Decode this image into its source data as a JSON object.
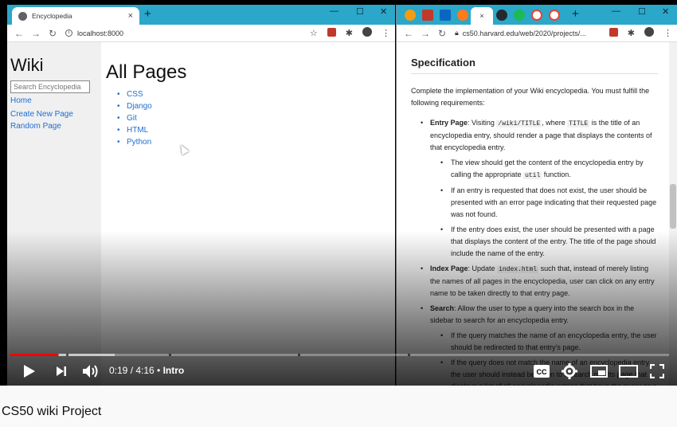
{
  "left_browser": {
    "tab_title": "Encyclopedia",
    "tab_close": "×",
    "new_tab": "+",
    "url": "localhost:8000",
    "win_min": "—",
    "win_max": "☐",
    "win_close": "✕"
  },
  "wiki": {
    "site_title": "Wiki",
    "search_placeholder": "Search Encyclopedia",
    "nav": [
      "Home",
      "Create New Page",
      "Random Page"
    ],
    "page_heading": "All Pages",
    "entries": [
      "CSS",
      "Django",
      "Git",
      "HTML",
      "Python"
    ]
  },
  "right_browser": {
    "active_tab_close": "×",
    "new_tab": "+",
    "url": "cs50.harvard.edu/web/2020/projects/...",
    "win_min": "—",
    "win_max": "☐",
    "win_close": "✕"
  },
  "spec": {
    "heading": "Specification",
    "intro": "Complete the implementation of your Wiki encyclopedia. You must fulfill the following requirements:",
    "entry_page": {
      "title": "Entry Page",
      "text_a": ": Visiting ",
      "code_a": "/wiki/TITLE",
      "text_b": ", where ",
      "code_b": "TITLE",
      "text_c": " is the title of an encyclopedia entry, should render a page that displays the contents of that encyclopedia entry.",
      "sub1_a": "The view should get the content of the encyclopedia entry by calling the appropriate ",
      "sub1_code": "util",
      "sub1_b": " function.",
      "sub2": "If an entry is requested that does not exist, the user should be presented with an error page indicating that their requested page was not found.",
      "sub3": "If the entry does exist, the user should be presented with a page that displays the content of the entry. The title of the page should include the name of the entry."
    },
    "index_page": {
      "title": "Index Page",
      "text_a": ": Update ",
      "code": "index.html",
      "text_b": " such that, instead of merely listing the names of all pages in the encyclopedia, user can click on any entry name to be taken directly to that entry page."
    },
    "search": {
      "title": "Search",
      "text": ": Allow the user to type a query into the search box in the sidebar to search for an encyclopedia entry.",
      "sub1": "If the query matches the name of an encyclopedia entry, the user should be redirected to that entry’s page.",
      "sub2": "If the query does not match the name of an encyclopedia entry, the user should instead be taken to a search results page that displays a list of all encyclopedia entries that have the query as a substring. For example, if the search"
    }
  },
  "player": {
    "time": "0:19 / 4:16",
    "separator": " • ",
    "chapter": "Intro",
    "progress": 0.074
  },
  "video_title": "CS50 wiki Project"
}
